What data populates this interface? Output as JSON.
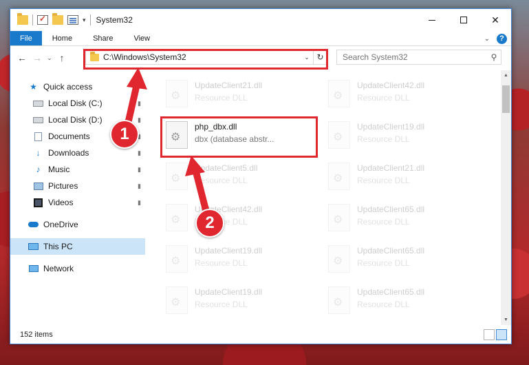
{
  "window": {
    "title": "System32",
    "controls": {
      "minimize": "",
      "maximize": "",
      "close": "✕"
    }
  },
  "quick_access_toolbar": {
    "dropdown": "▾"
  },
  "ribbon": {
    "tabs": [
      "File",
      "Home",
      "Share",
      "View"
    ],
    "collapse": "⌄",
    "help": "?"
  },
  "nav": {
    "back": "←",
    "forward": "→",
    "recent": "⌄",
    "up": "↑",
    "address": "C:\\Windows\\System32",
    "address_dropdown": "⌄",
    "refresh": "↻",
    "search_placeholder": "Search System32",
    "search_icon": "⚲"
  },
  "sidebar": {
    "items": [
      {
        "label": "Quick access",
        "icon": "star-icon"
      },
      {
        "label": "Local Disk (C:)",
        "icon": "drive-icon",
        "pinned": true
      },
      {
        "label": "Local Disk (D:)",
        "icon": "drive-icon",
        "pinned": true
      },
      {
        "label": "Documents",
        "icon": "documents-icon",
        "pinned": true
      },
      {
        "label": "Downloads",
        "icon": "downloads-icon",
        "pinned": true
      },
      {
        "label": "Music",
        "icon": "music-icon",
        "pinned": true
      },
      {
        "label": "Pictures",
        "icon": "pictures-icon",
        "pinned": true
      },
      {
        "label": "Videos",
        "icon": "videos-icon",
        "pinned": true
      },
      {
        "label": "OneDrive",
        "icon": "onedrive-icon"
      },
      {
        "label": "This PC",
        "icon": "this-pc-icon",
        "selected": true
      },
      {
        "label": "Network",
        "icon": "network-icon"
      }
    ],
    "pin_glyph": "📌"
  },
  "files": {
    "highlighted": {
      "name": "php_dbx.dll",
      "description": "dbx (database abstr..."
    },
    "faded": [
      {
        "name": "UpdateClient21.dll",
        "description": "Resource DLL"
      },
      {
        "name": "UpdateClient42.dll",
        "description": "Resource DLL"
      },
      {
        "name": "UpdateClient19.dll",
        "description": "Resource DLL"
      },
      {
        "name": "UpdateClient5.dll",
        "description": "Resource DLL"
      },
      {
        "name": "UpdateClient21.dll",
        "description": "Resource DLL"
      },
      {
        "name": "UpdateClient42.dll",
        "description": "Resource DLL"
      },
      {
        "name": "UpdateClient65.dll",
        "description": "Resource DLL"
      },
      {
        "name": "UpdateClient19.dll",
        "description": "Resource DLL"
      },
      {
        "name": "UpdateClient65.dll",
        "description": "Resource DLL"
      },
      {
        "name": "UpdateClient19.dll",
        "description": "Resource DLL"
      },
      {
        "name": "UpdateClient65.dll",
        "description": "Resource DLL"
      }
    ]
  },
  "status": {
    "item_count": "152 items"
  },
  "callouts": [
    "1",
    "2"
  ],
  "colors": {
    "accent": "#1979ca",
    "highlight_red": "#e0262f",
    "selected_bg": "#cce4f7"
  }
}
